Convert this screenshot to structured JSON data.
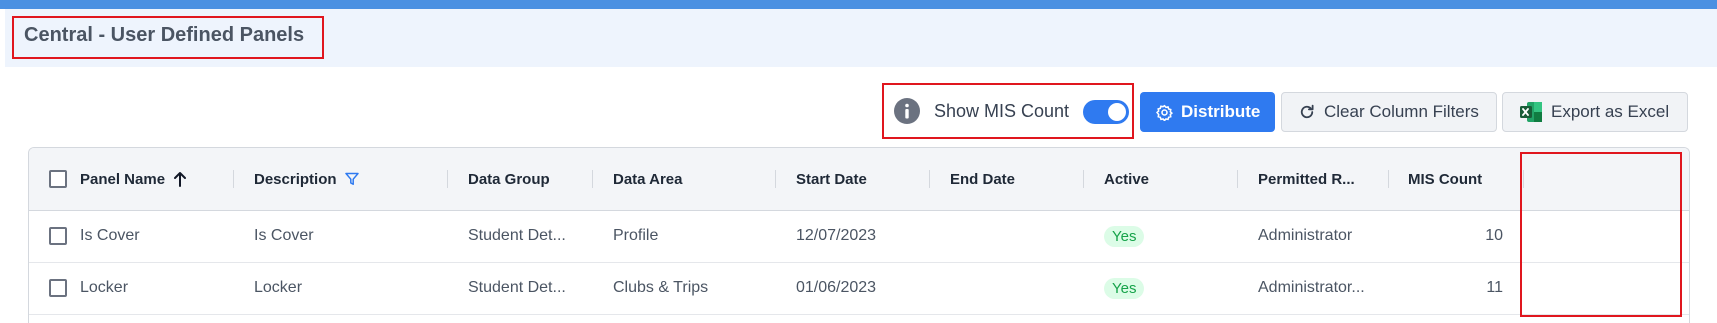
{
  "page": {
    "title": "Central - User Defined Panels"
  },
  "toolbar": {
    "mis_label": "Show MIS Count",
    "mis_enabled": true,
    "distribute_label": "Distribute",
    "clear_filters_label": "Clear Column Filters",
    "export_label": "Export as Excel"
  },
  "grid": {
    "columns": [
      {
        "label": "Panel Name",
        "sort": "ascending"
      },
      {
        "label": "Description",
        "filter_active": true
      },
      {
        "label": "Data Group"
      },
      {
        "label": "Data Area"
      },
      {
        "label": "Start Date"
      },
      {
        "label": "End Date"
      },
      {
        "label": "Active"
      },
      {
        "label": "Permitted R..."
      },
      {
        "label": "MIS Count"
      }
    ],
    "rows": [
      {
        "panel_name": "Is Cover",
        "description": "Is Cover",
        "data_group": "Student Det...",
        "data_area": "Profile",
        "start_date": "12/07/2023",
        "end_date": "",
        "active": "Yes",
        "permitted": "Administrator",
        "mis_count": "10"
      },
      {
        "panel_name": "Locker",
        "description": "Locker",
        "data_group": "Student Det...",
        "data_area": "Clubs & Trips",
        "start_date": "01/06/2023",
        "end_date": "",
        "active": "Yes",
        "permitted": "Administrator...",
        "mis_count": "11"
      }
    ]
  },
  "colors": {
    "accent": "#2f7af0",
    "highlight": "#e0161e",
    "active_badge": "#16a34a"
  }
}
